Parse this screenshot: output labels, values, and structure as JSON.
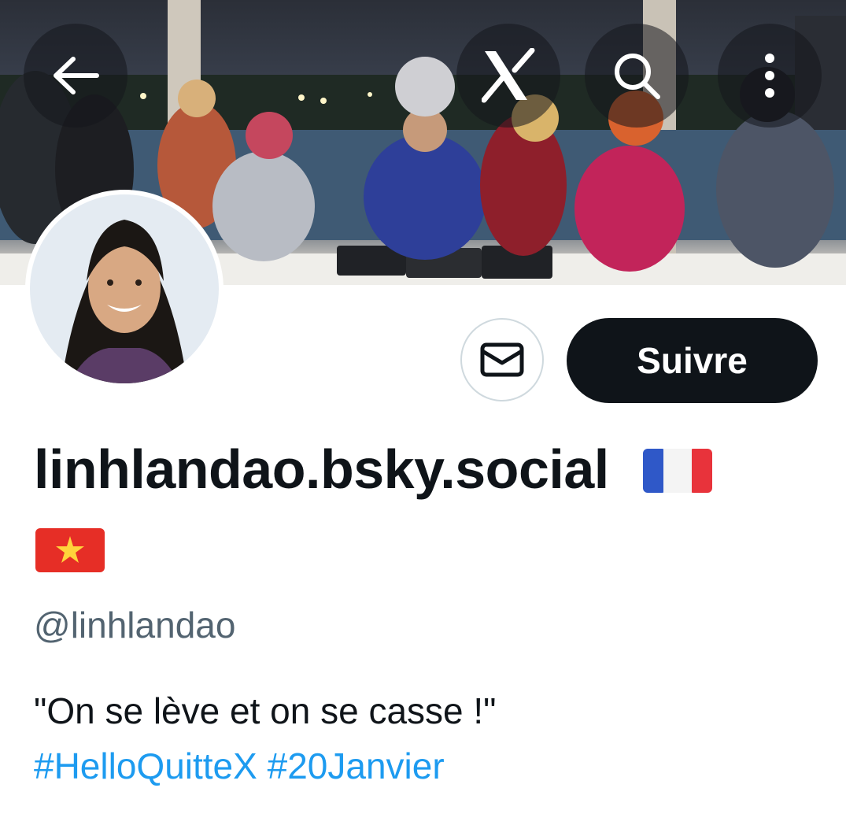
{
  "header": {
    "back_icon": "arrow-left-icon",
    "logo_icon": "x-logo-icon",
    "search_icon": "search-icon",
    "more_icon": "more-vertical-icon",
    "overlay_color": "#14161c"
  },
  "profile": {
    "display_name": "linhlandao.bsky.social",
    "flags": [
      "France flag",
      "Vietnam flag"
    ],
    "handle": "@linhlandao",
    "bio_text": "\"On se lève et on se casse !\"",
    "hashtags": [
      "#HelloQuitteX",
      "#20Janvier"
    ]
  },
  "actions": {
    "message_icon": "envelope-icon",
    "follow_label": "Suivre"
  },
  "colors": {
    "text": "#0f1419",
    "secondary_text": "#536471",
    "link": "#1d9bf0",
    "follow_button": "#0f1419",
    "border": "#cfd9de"
  }
}
